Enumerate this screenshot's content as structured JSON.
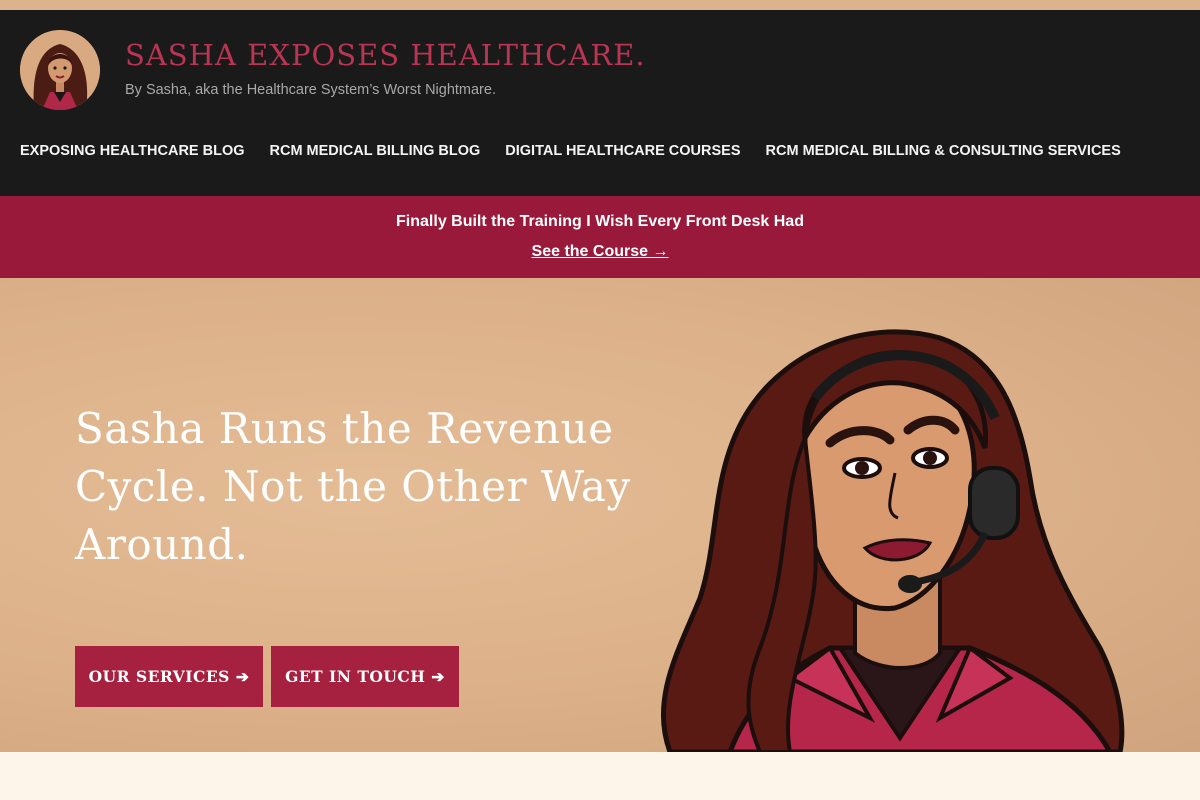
{
  "site": {
    "title": "SASHA EXPOSES HEALTHCARE.",
    "tagline": "By Sasha, aka the Healthcare System’s Worst Nightmare."
  },
  "nav": {
    "items": [
      {
        "label": "EXPOSING HEALTHCARE BLOG"
      },
      {
        "label": "RCM MEDICAL BILLING BLOG"
      },
      {
        "label": "DIGITAL HEALTHCARE COURSES"
      },
      {
        "label": "RCM MEDICAL BILLING & CONSULTING SERVICES"
      }
    ]
  },
  "promo": {
    "text": "Finally Built the Training I Wish Every Front Desk Had",
    "link_label": "See the Course →"
  },
  "hero": {
    "heading": "Sasha Runs the Revenue Cycle. Not the Other Way Around.",
    "buttons": {
      "services": "OUR SERVICES",
      "touch": "GET IN TOUCH",
      "arrow": "➔"
    }
  },
  "colors": {
    "header_bg": "#1b1a1a",
    "title": "#b93553",
    "promo_bg": "#99193b",
    "button_bg": "#a6213f",
    "hero_bg": "#dcb189"
  }
}
